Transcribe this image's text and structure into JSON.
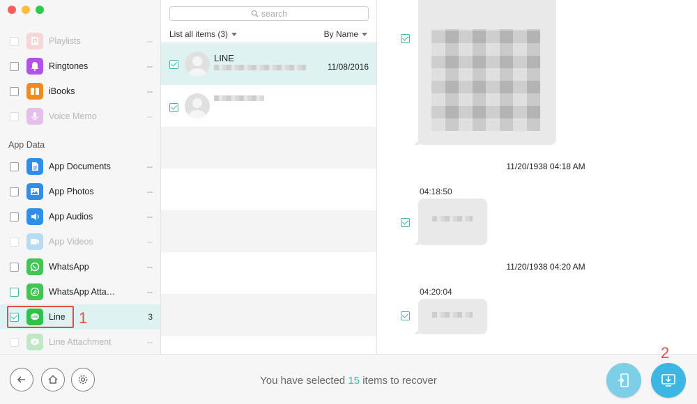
{
  "window": {
    "controls": [
      "close",
      "minimize",
      "maximize"
    ]
  },
  "sidebar": {
    "items": [
      {
        "label": "Playlists",
        "count": "--",
        "icon": "playlist-icon",
        "color": "#f3a3a7",
        "dim": true,
        "checked": false
      },
      {
        "label": "Ringtones",
        "count": "--",
        "icon": "bell-icon",
        "color": "#b452e8",
        "dim": false,
        "checked": false
      },
      {
        "label": "iBooks",
        "count": "--",
        "icon": "book-icon",
        "color": "#f28b1f",
        "dim": false,
        "checked": false
      },
      {
        "label": "Voice Memo",
        "count": "--",
        "icon": "microphone-icon",
        "color": "#cf7be0",
        "dim": true,
        "checked": false
      }
    ],
    "section_app_data": "App Data",
    "app_items": [
      {
        "label": "App Documents",
        "count": "--",
        "icon": "document-icon",
        "color": "#2f8fe8",
        "dim": false,
        "checked": false
      },
      {
        "label": "App Photos",
        "count": "--",
        "icon": "photo-icon",
        "color": "#2f8fe8",
        "dim": false,
        "checked": false
      },
      {
        "label": "App Audios",
        "count": "--",
        "icon": "speaker-icon",
        "color": "#2f8fe8",
        "dim": false,
        "checked": false
      },
      {
        "label": "App Videos",
        "count": "--",
        "icon": "video-icon",
        "color": "#6ec1f0",
        "dim": true,
        "checked": false
      },
      {
        "label": "WhatsApp",
        "count": "--",
        "icon": "whatsapp-icon",
        "color": "#43c553",
        "dim": false,
        "checked": false
      },
      {
        "label": "WhatsApp Atta…",
        "count": "--",
        "icon": "paperclip-icon",
        "color": "#43c553",
        "dim": false,
        "checked": false
      },
      {
        "label": "Line",
        "count": "3",
        "icon": "line-icon",
        "color": "#2fc148",
        "dim": false,
        "checked": true
      },
      {
        "label": "Line Attachment",
        "count": "--",
        "icon": "line-attachment-icon",
        "color": "#7fd98c",
        "dim": true,
        "checked": false
      }
    ]
  },
  "annotations": {
    "step1": "1",
    "step2": "2"
  },
  "list": {
    "search_placeholder": "search",
    "filter_label": "List all items (3)",
    "sort_label": "By Name",
    "contacts": [
      {
        "name": "LINE",
        "date": "11/08/2016",
        "checked": true
      },
      {
        "name": "",
        "date": "",
        "checked": true
      }
    ]
  },
  "messages": {
    "groups": [
      {
        "date": "11/20/1938 04:18 AM",
        "time": "04:18:50"
      },
      {
        "date": "11/20/1938 04:20 AM",
        "time": "04:20:04"
      }
    ]
  },
  "bottom": {
    "status_prefix": "You have selected",
    "status_count": "15",
    "status_suffix": "items to recover",
    "buttons": [
      "back-icon",
      "home-icon",
      "settings-icon"
    ],
    "actions": [
      "recover-to-device-icon",
      "recover-to-computer-icon"
    ]
  }
}
